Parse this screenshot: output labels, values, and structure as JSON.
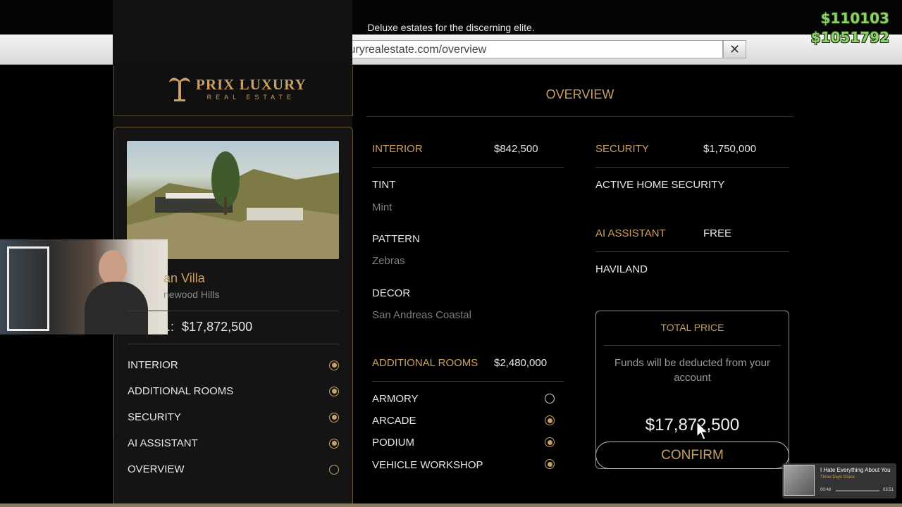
{
  "header": {
    "tagline": "Deluxe estates for the discerning elite.",
    "url": "www.prixluxuryrealestate.com/overview"
  },
  "hud": {
    "cash": "$110103",
    "bank": "$1051792"
  },
  "logo": {
    "line1": "PRIX LUXURY",
    "line2": "REAL ESTATE"
  },
  "property": {
    "name_partial": "an Villa",
    "location_partial": "newood Hills",
    "price_prefix": ".:",
    "price": "$17,872,500"
  },
  "nav": [
    {
      "label": "INTERIOR",
      "state": "on"
    },
    {
      "label": "ADDITIONAL ROOMS",
      "state": "on"
    },
    {
      "label": "SECURITY",
      "state": "on"
    },
    {
      "label": "AI ASSISTANT",
      "state": "on"
    },
    {
      "label": "OVERVIEW",
      "state": "off"
    }
  ],
  "overview": {
    "title": "OVERVIEW",
    "interior": {
      "label": "INTERIOR",
      "price": "$842,500",
      "tint_label": "TINT",
      "tint_value": "Mint",
      "pattern_label": "PATTERN",
      "pattern_value": "Zebras",
      "decor_label": "DECOR",
      "decor_value": "San Andreas Coastal"
    },
    "additional_rooms": {
      "label": "ADDITIONAL ROOMS",
      "price": "$2,480,000",
      "items": [
        {
          "label": "ARMORY",
          "selected": false
        },
        {
          "label": "ARCADE",
          "selected": true
        },
        {
          "label": "PODIUM",
          "selected": true
        },
        {
          "label": "VEHICLE WORKSHOP",
          "selected": true
        }
      ]
    },
    "security": {
      "label": "SECURITY",
      "price": "$1,750,000",
      "value": "ACTIVE HOME SECURITY"
    },
    "ai_assistant": {
      "label": "AI ASSISTANT",
      "price": "FREE",
      "value": "HAVILAND"
    },
    "total": {
      "title": "TOTAL PRICE",
      "note": "Funds will be deducted from your account",
      "amount": "$17,872,500",
      "confirm_label": "CONFIRM"
    }
  },
  "music": {
    "title": "I Hate Everything About You",
    "artist": "Three Days Grace",
    "elapsed": "00:48",
    "duration": "03:51"
  },
  "colors": {
    "accent": "#c9a062",
    "cash": "#8ed06a"
  }
}
